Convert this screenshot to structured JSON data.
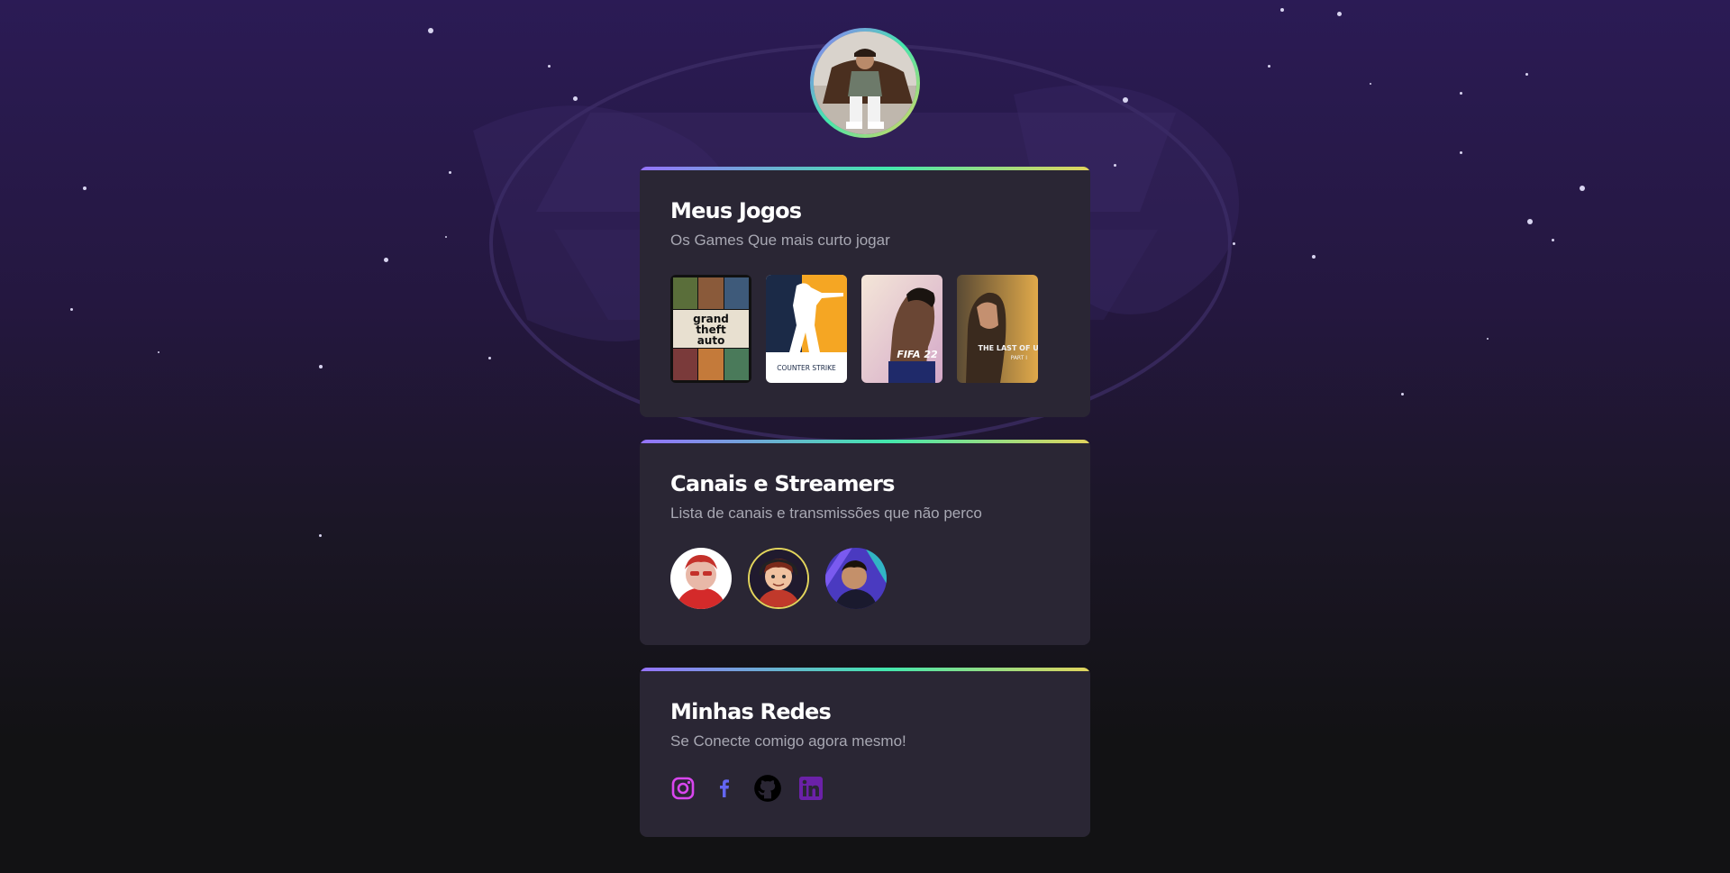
{
  "profile": {
    "avatar_icon": "profile-photo"
  },
  "games_card": {
    "title": "Meus Jogos",
    "subtitle": "Os Games Que mais curto jogar",
    "games": [
      {
        "name": "GTA V",
        "cover_text": [
          "grand",
          "theft",
          "auto"
        ]
      },
      {
        "name": "Counter Strike",
        "cover_text": "COUNTER STRIKE"
      },
      {
        "name": "FIFA 22",
        "cover_text": "FIFA 22"
      },
      {
        "name": "The Last of Us Part I",
        "cover_text": "THE LAST OF US",
        "cover_subtext": "PART I"
      }
    ]
  },
  "streamers_card": {
    "title": "Canais e Streamers",
    "subtitle": "Lista de canais e transmissões que não perco",
    "streamers": [
      {
        "icon": "streamer-avatar-1"
      },
      {
        "icon": "streamer-avatar-2"
      },
      {
        "icon": "streamer-avatar-3"
      }
    ]
  },
  "social_card": {
    "title": "Minhas Redes",
    "subtitle": "Se Conecte comigo agora mesmo!",
    "links": [
      {
        "icon": "instagram-icon",
        "color": "#d946ef"
      },
      {
        "icon": "facebook-icon",
        "color": "#6366f1"
      },
      {
        "icon": "github-icon",
        "color": "#000000"
      },
      {
        "icon": "linkedin-icon",
        "color": "#6b21a8"
      }
    ]
  },
  "colors": {
    "card_bg": "#2a2634",
    "gradient": [
      "#9572fc",
      "#43e7ad",
      "#e2d45c"
    ],
    "text_secondary": "#a8a8b3"
  }
}
